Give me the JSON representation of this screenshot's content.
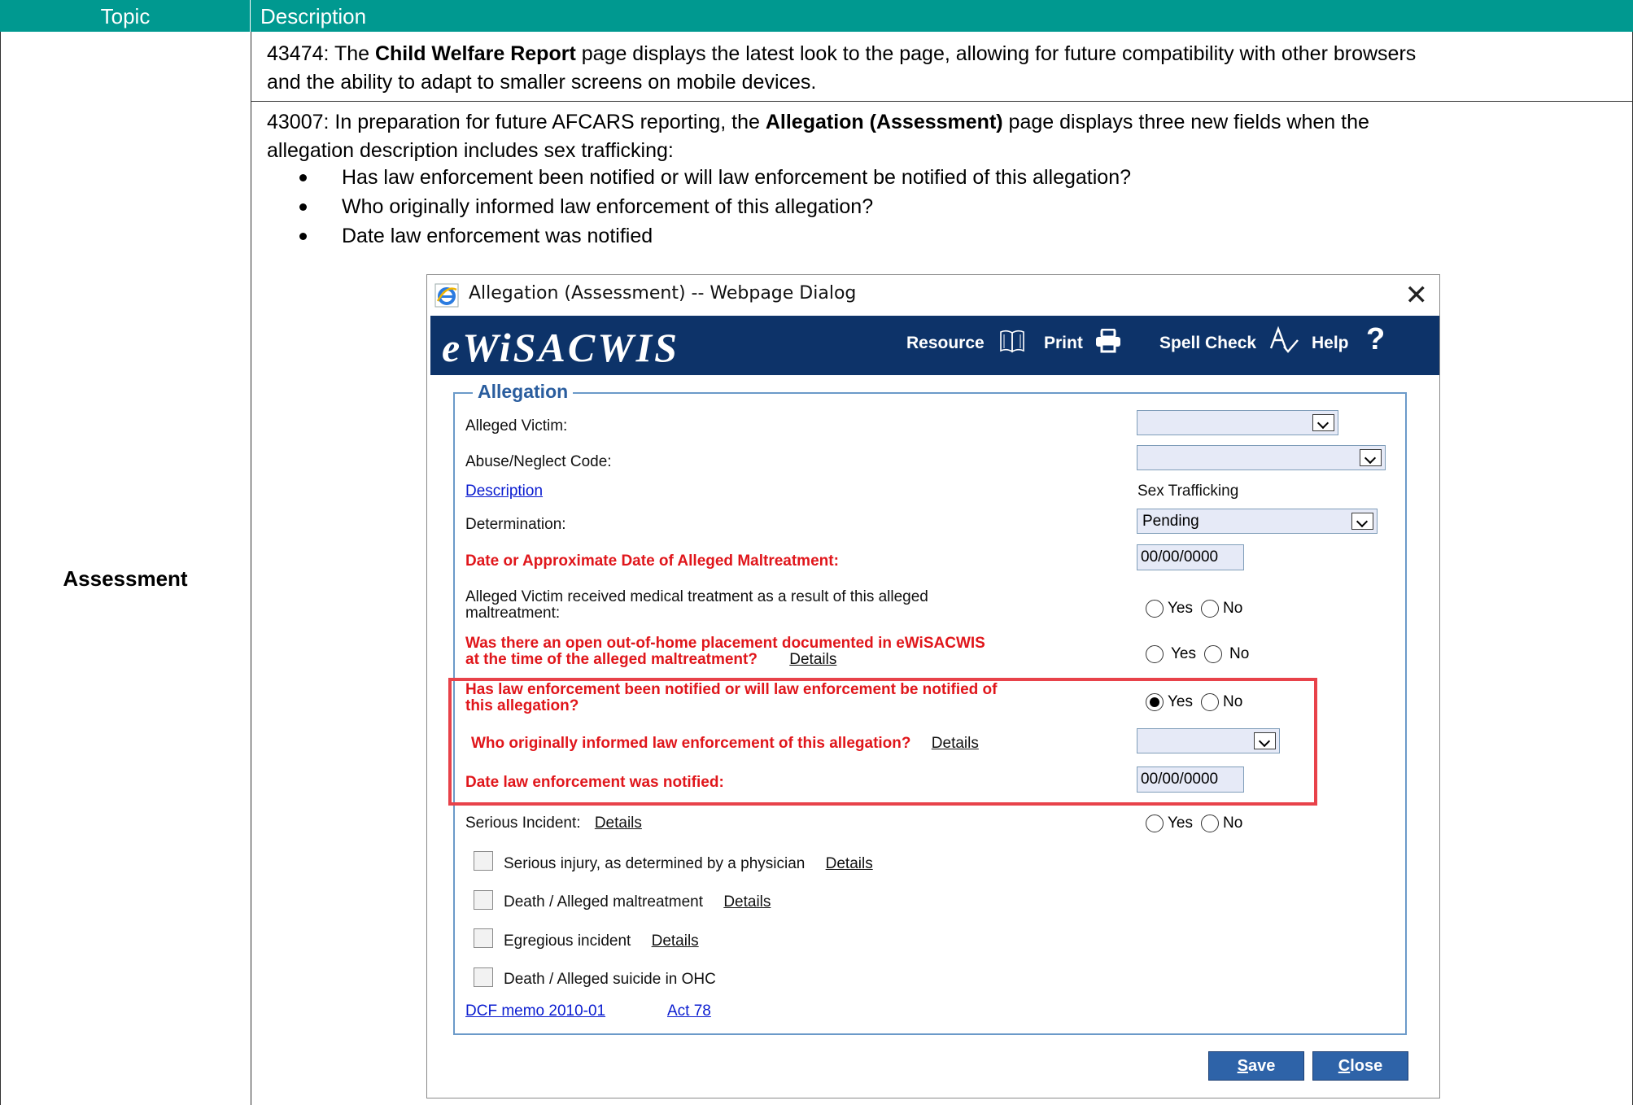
{
  "table": {
    "header_topic": "Topic",
    "header_description": "Description",
    "topic": "Assessment"
  },
  "rows": [
    {
      "lead": "43474: The ",
      "bold": "Child Welfare Report",
      "tail_line1": " page displays the latest look to the page, allowing for future compatibility with other browsers",
      "line2": "and the ability to adapt to smaller screens on mobile devices."
    },
    {
      "lead": "43007: In preparation for future AFCARS reporting, the ",
      "bold": "Allegation (Assessment)",
      "tail_line1": " page displays three new fields when the",
      "line2": "allegation description includes sex trafficking:",
      "bullets": [
        "Has law enforcement been notified or will law enforcement be notified of this allegation?",
        "Who originally informed law enforcement of this allegation?",
        "Date law enforcement was notified"
      ]
    }
  ],
  "dialog": {
    "title": "Allegation (Assessment) -- Webpage Dialog",
    "logo": "eWiSACWIS",
    "banner": {
      "resource": "Resource",
      "print": "Print",
      "spell_check": "Spell Check",
      "help": "Help",
      "help_mark": "?"
    },
    "section": "Allegation",
    "fields": {
      "alleged_victim": "Alleged Victim:",
      "abuse_code": "Abuse/Neglect Code:",
      "description_link": "Description",
      "description_value": "Sex Trafficking",
      "determination": "Determination:",
      "determination_value": "Pending",
      "date_maltreatment": "Date or Approximate Date of Alleged Maltreatment:",
      "date_maltreatment_value": "00/00/0000",
      "medical_1": "Alleged Victim received medical treatment as a result of this alleged",
      "medical_2": "maltreatment:",
      "placement_1": "Was there an open out-of-home placement documented in eWiSACWIS",
      "placement_2": "at the time of the alleged maltreatment?",
      "law_notified_1": "Has law enforcement been notified or will law enforcement be notified of",
      "law_notified_2": "this allegation?",
      "who_informed": "Who originally informed law enforcement of this allegation?",
      "date_law": "Date law enforcement was notified:",
      "date_law_value": "00/00/0000",
      "serious_incident": "Serious Incident:",
      "cb_serious_injury": "Serious injury, as determined by a physician",
      "cb_death_maltreatment": "Death / Alleged maltreatment",
      "cb_egregious": "Egregious incident",
      "cb_death_suicide": "Death / Alleged suicide in OHC",
      "details": "Details",
      "yes": "Yes",
      "no": "No"
    },
    "links": {
      "memo": "DCF memo 2010-01",
      "act": "Act 78"
    },
    "buttons": {
      "save_u": "S",
      "save_rest": "ave",
      "close_u": "C",
      "close_rest": "lose"
    }
  },
  "colors": {
    "header_teal": "#009990",
    "banner_navy": "#0d3369",
    "required_red": "#e0161b",
    "highlight_red": "#e8424a",
    "button_blue": "#2e63a8"
  }
}
